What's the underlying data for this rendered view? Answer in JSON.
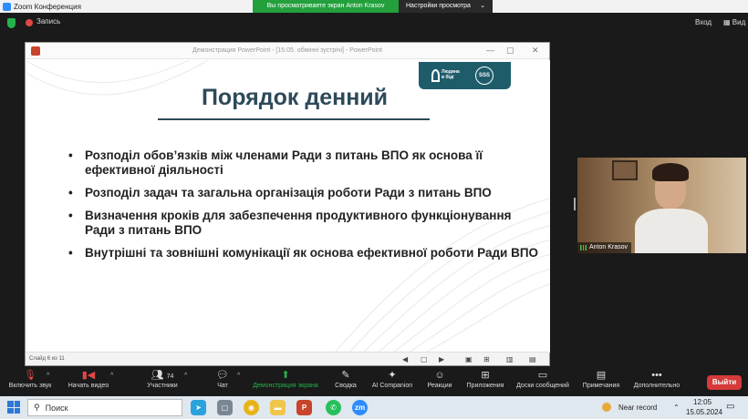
{
  "window": {
    "title": "Zoom Конференция"
  },
  "banner": {
    "sharing_text": "Вы просматриваете экран Anton Krasov",
    "view_options": "Настройки просмотра"
  },
  "zoom_top": {
    "recording": "Запись",
    "enter": "Вход",
    "view": "Вид"
  },
  "ppt": {
    "window_title": "Демонстрация PowerPoint - [15.05. обмінні зустрічі] - PowerPoint",
    "slide_counter": "Слайд 6 из 11"
  },
  "slide": {
    "title": "Порядок денний",
    "logo_text_1": "Людина",
    "logo_text_2": "в біді",
    "logo_badge": "SSS",
    "bullets": [
      "Розподіл обов’язків між членами Ради з питань ВПО як основа її ефективної діяльності",
      "Розподіл задач та загальна організація роботи Ради з питань ВПО",
      "Визначення кроків для забезпечення продуктивного функціонування Ради з питань ВПО",
      "Внутрішні та зовнішні комунікації як основа ефективної роботи Ради ВПО"
    ]
  },
  "video": {
    "participant_name": "Anton Krasov"
  },
  "toolbar": {
    "audio": "Включить звук",
    "video": "Начать видео",
    "participants": "Участники",
    "participants_count": "74",
    "chat": "Чат",
    "share": "Демонстрация экрана",
    "summary": "Сводка",
    "ai": "AI Companion",
    "reactions": "Реакции",
    "apps": "Приложения",
    "whiteboards": "Доски сообщений",
    "notes": "Примечания",
    "more": "Дополнительно",
    "leave": "Выйти"
  },
  "taskbar": {
    "search_placeholder": "Поиск",
    "near_record": "Near record",
    "time": "12:05",
    "date": "15.05.2024"
  }
}
